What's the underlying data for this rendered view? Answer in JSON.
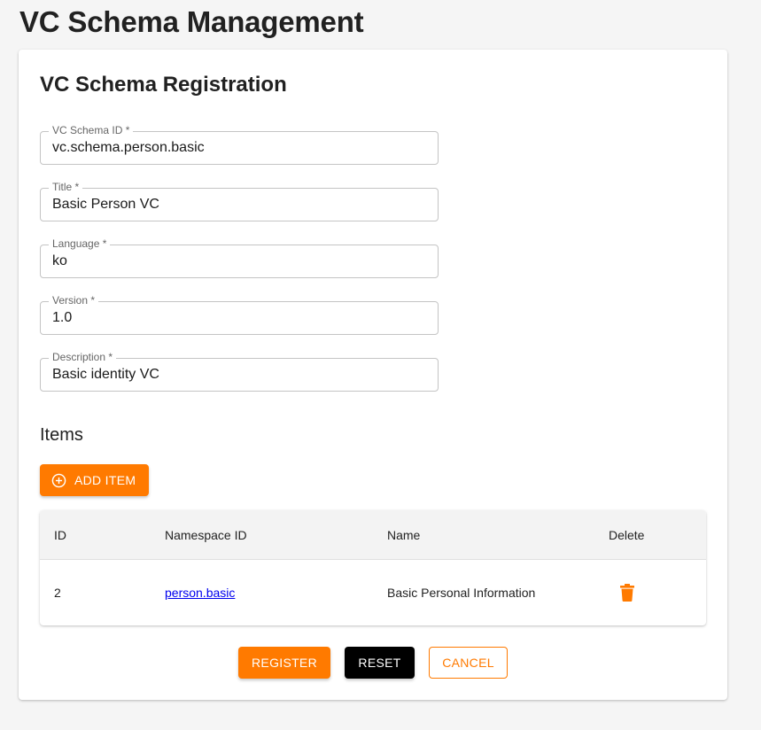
{
  "page": {
    "title": "VC Schema Management"
  },
  "form": {
    "title": "VC Schema Registration",
    "fields": [
      {
        "label": "VC Schema ID *",
        "value": "vc.schema.person.basic"
      },
      {
        "label": "Title *",
        "value": "Basic Person VC"
      },
      {
        "label": "Language *",
        "value": "ko"
      },
      {
        "label": "Version *",
        "value": "1.0"
      },
      {
        "label": "Description *",
        "value": "Basic identity VC"
      }
    ]
  },
  "items": {
    "title": "Items",
    "add_label": "ADD ITEM",
    "add_icon": "plus-circle-icon",
    "columns": [
      "ID",
      "Namespace ID",
      "Name",
      "Delete"
    ],
    "rows": [
      {
        "id": "2",
        "namespace_id": "person.basic",
        "name": "Basic Personal Information",
        "delete_icon": "trash-icon"
      }
    ]
  },
  "actions": {
    "register_label": "REGISTER",
    "reset_label": "RESET",
    "cancel_label": "CANCEL"
  },
  "colors": {
    "accent": "#ff7a00",
    "reset_bg": "#000000",
    "link": "#0000ee"
  }
}
